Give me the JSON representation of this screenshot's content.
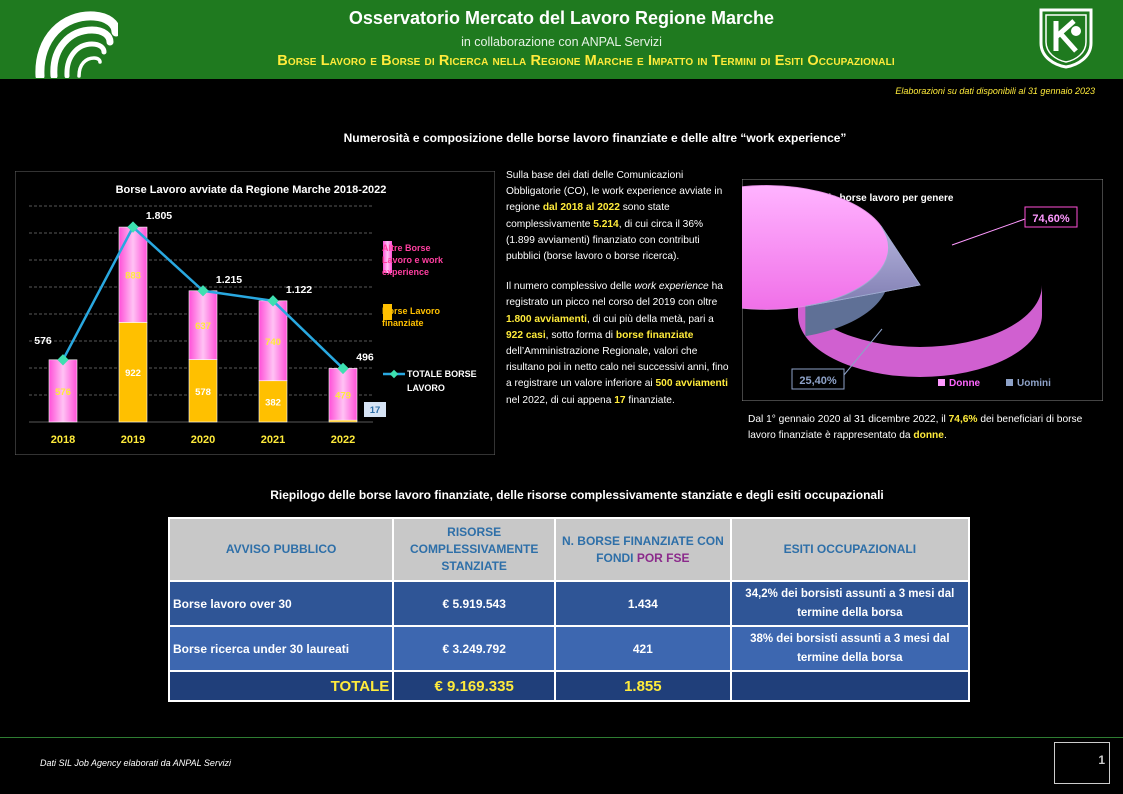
{
  "header": {
    "title": "Osservatorio Mercato del Lavoro Regione Marche",
    "subtitle": "in collaborazione con ANPAL Servizi",
    "main_title": "Borse Lavoro e Borse di Ricerca nella Regione Marche e Impatto in Termini di Esiti Occupazionali",
    "colors": {
      "bar": "#1f7a1f",
      "accent": "#ffeb3b"
    }
  },
  "elab_note": "Elaborazioni su dati disponibili al 31 gennaio 2023",
  "section1_title": "Numerosità e composizione delle borse lavoro finanziate e delle altre “work experience”",
  "chart_data": [
    {
      "type": "bar",
      "title": "Borse Lavoro avviate da Regione Marche  2018-2022",
      "categories": [
        "2018",
        "2019",
        "2020",
        "2021",
        "2022"
      ],
      "stacked": true,
      "series": [
        {
          "name": "Borse Lavoro finanziate",
          "values": [
            null,
            922,
            578,
            382,
            17
          ],
          "color": "#ffc000"
        },
        {
          "name": "Altre Borse Lavoro e work experience",
          "values": [
            576,
            883,
            637,
            740,
            479
          ],
          "color": "#ff80ff"
        },
        {
          "name": "TOTALE BORSE LAVORO",
          "type": "line",
          "values": [
            576,
            1805,
            1215,
            1122,
            496
          ],
          "color": "#29a8e0"
        }
      ],
      "total_labels": [
        "576",
        "1.805",
        "1.215",
        "1.122",
        "496"
      ],
      "finanziate_labels": [
        "",
        "922",
        "578",
        "382",
        "17"
      ],
      "altre_labels": [
        "576",
        "883",
        "637",
        "740",
        "479"
      ],
      "ylim": [
        0,
        2000
      ],
      "grid": true,
      "legend": "right"
    },
    {
      "type": "pie",
      "title": "Beneficiari delle borse lavoro per genere",
      "categories": [
        "Donne",
        "Uomini"
      ],
      "values": [
        74.6,
        25.4
      ],
      "labels": [
        "74,60%",
        "25,40%"
      ],
      "colors": [
        "#ff99ff",
        "#8ea2c8"
      ],
      "legend": "bottom-right"
    }
  ],
  "mid_text": {
    "p1": [
      "Sulla base dei dati delle Comunicazioni Obbligatorie (CO), le work experience avviate in regione ",
      "dal 2018 al 2022",
      " sono state complessivamente ",
      "5.214",
      ", di cui circa il 36% (1.899 avviamenti) finanziato con contributi pubblici (borse lavoro o borse ricerca)."
    ],
    "p2": [
      "Il numero complessivo delle ",
      "work experience",
      " ha registrato un picco nel corso del 2019 con oltre ",
      "1.800 avviamenti",
      ", di cui più della metà, pari a ",
      "922 casi",
      ", sotto forma di ",
      "borse finanziate",
      " dell’Amministrazione Regionale, valori che risultano poi in netto calo nei successivi anni, fino a registrare un valore inferiore ai ",
      "500 avviamenti",
      " nel 2022, di cui appena ",
      "17",
      " finanziate."
    ]
  },
  "pie_caption": [
    "Dal 1° gennaio 2020 al 31 dicembre 2022, il ",
    "74,6%",
    " dei beneficiari di borse lavoro finanziate è rappresentato da ",
    "donne",
    "."
  ],
  "section2_title": "Riepilogo delle borse lavoro finanziate, delle risorse complessivamente stanziate e degli esiti occupazionali",
  "table": {
    "headers": {
      "avviso": "AVVISO PUBBLICO",
      "risorse": "RISORSE COMPLESSIVAMENTE STANZIATE",
      "borse_pre": "N. BORSE FINANZIATE CON FONDI ",
      "borse_por": "POR FSE",
      "esiti": "ESITI OCCUPAZIONALI"
    },
    "rows": [
      {
        "avviso": "Borse lavoro over 30",
        "risorse": "€ 5.919.543",
        "borse": "1.434",
        "esiti": "34,2% dei borsisti assunti a 3 mesi dal termine della borsa"
      },
      {
        "avviso": "Borse ricerca under 30 laureati",
        "risorse": "€ 3.249.792",
        "borse": "421",
        "esiti": "38% dei borsisti assunti a 3 mesi dal termine della borsa"
      }
    ],
    "total": {
      "label": "TOTALE",
      "risorse": "€ 9.169.335",
      "borse": "1.855",
      "esiti": ""
    }
  },
  "footer": {
    "source": "Dati SIL Job Agency elaborati da ANPAL Servizi",
    "page": "1"
  }
}
